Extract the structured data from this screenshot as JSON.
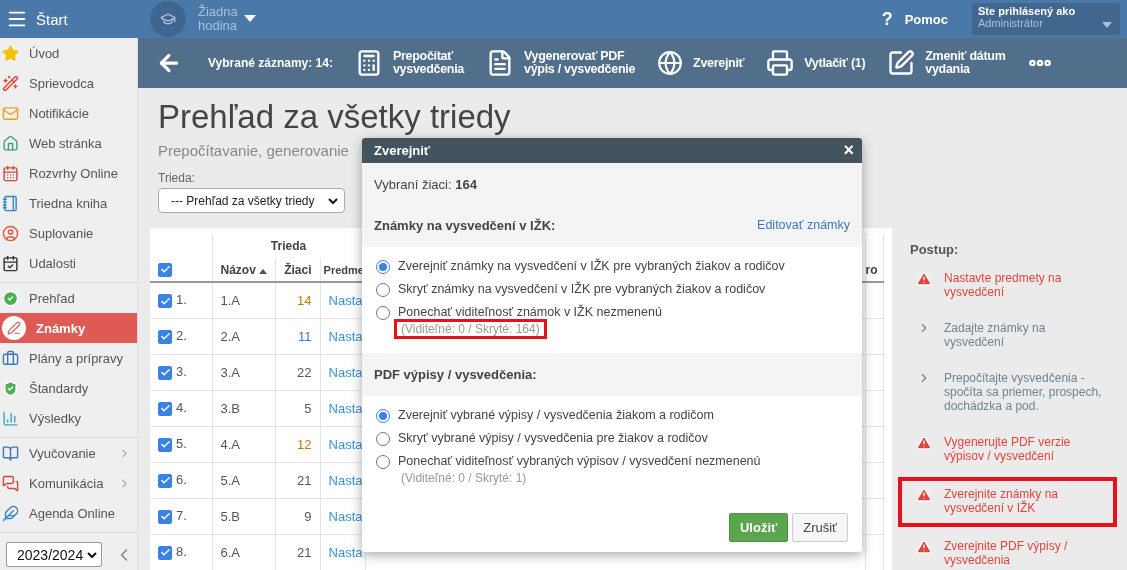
{
  "topbar": {
    "menu_label": "Štart",
    "lesson": [
      "Žiadna",
      "hodina"
    ],
    "help_glyph": "?",
    "help_label": "Pomoc",
    "user_caption": "Ste prihlásený ako",
    "user_name": "Administrátor"
  },
  "sidebar": {
    "sections": [
      [
        {
          "label": "Úvod",
          "selected": false,
          "has_submenu": false
        },
        {
          "label": "Sprievodca",
          "selected": false,
          "has_submenu": false
        },
        {
          "label": "Notifikácie",
          "selected": false,
          "has_submenu": false
        },
        {
          "label": "Web stránka",
          "selected": false,
          "has_submenu": false
        },
        {
          "label": "Rozvrhy Online",
          "selected": false,
          "has_submenu": false
        },
        {
          "label": "Triedna kniha",
          "selected": false,
          "has_submenu": false
        },
        {
          "label": "Suplovanie",
          "selected": false,
          "has_submenu": false
        },
        {
          "label": "Udalosti",
          "selected": false,
          "has_submenu": false
        }
      ],
      [
        {
          "label": "Prehľad",
          "selected": false,
          "has_submenu": false
        },
        {
          "label": "Známky",
          "selected": true,
          "has_submenu": false
        },
        {
          "label": "Plány a prípravy",
          "selected": false,
          "has_submenu": false
        },
        {
          "label": "Štandardy",
          "selected": false,
          "has_submenu": false
        },
        {
          "label": "Výsledky",
          "selected": false,
          "has_submenu": false
        }
      ],
      [
        {
          "label": "Vyučovanie",
          "selected": false,
          "has_submenu": true
        },
        {
          "label": "Komunikácia",
          "selected": false,
          "has_submenu": true
        },
        {
          "label": "Agenda Online",
          "selected": false,
          "has_submenu": false
        }
      ]
    ],
    "year": "2023/2024"
  },
  "toolbar": {
    "selection": "Vybrané záznamy: 14:",
    "actions": [
      {
        "label": [
          "Prepočítať",
          "vysvedčenia"
        ]
      },
      {
        "label": [
          "Vygenerovať PDF",
          "výpis / vysvedčenie"
        ]
      },
      {
        "label": [
          "Zverejniť"
        ]
      },
      {
        "label": [
          "Vytlačiť (1)"
        ]
      },
      {
        "label": [
          "Zmeniť dátum",
          "vydania"
        ]
      }
    ]
  },
  "page": {
    "title": "Prehľad za všetky triedy",
    "subtitle": "Prepočítavanie, generovanie",
    "filter_label": "Trieda:",
    "filter_value": "--- Prehľad za všetky triedy"
  },
  "table": {
    "group_header": "Trieda",
    "select_all_checked": true,
    "columns": [
      "Názov",
      "Žiaci",
      "Predme",
      "ro"
    ],
    "rows": [
      {
        "number": "1.",
        "name": "1.A",
        "students": "14",
        "color": "#c47a00",
        "link": "Nasta",
        "checked": true
      },
      {
        "number": "2.",
        "name": "2.A",
        "students": "11",
        "color": "#3a78c2",
        "link": "Nasta",
        "checked": true
      },
      {
        "number": "3.",
        "name": "3.A",
        "students": "22",
        "color": "#555555",
        "link": "Nasta",
        "checked": true
      },
      {
        "number": "4.",
        "name": "3.B",
        "students": "5",
        "color": "#555555",
        "link": "Nasta",
        "checked": true
      },
      {
        "number": "5.",
        "name": "4.A",
        "students": "12",
        "color": "#c47a00",
        "link": "Nasta",
        "checked": true
      },
      {
        "number": "6.",
        "name": "5.A",
        "students": "21",
        "color": "#555555",
        "link": "Nasta",
        "checked": true
      },
      {
        "number": "7.",
        "name": "5.B",
        "students": "9",
        "color": "#555555",
        "link": "Nasta",
        "checked": true
      },
      {
        "number": "8.",
        "name": "6.A",
        "students": "21",
        "color": "#555555",
        "link": "Nasta",
        "checked": true
      }
    ]
  },
  "steps": {
    "title": "Postup:",
    "items": [
      {
        "kind": "warning",
        "text": "Nastavte predmety na vysvedčení",
        "highlighted": false
      },
      {
        "kind": "pending",
        "text": "Zadajte známky na vysvedčení",
        "highlighted": false
      },
      {
        "kind": "pending",
        "text": "Prepočítajte vysvedčenia - spočíta sa priemer, prospech, dochádzka a pod.",
        "highlighted": false
      },
      {
        "kind": "warning",
        "text": "Vygenerujte PDF verzie výpisov / vysvedčení",
        "highlighted": false
      },
      {
        "kind": "warning",
        "text": "Zverejnite známky na vysvedčení v IŽK",
        "highlighted": true
      },
      {
        "kind": "warning",
        "text": "Zverejnite PDF výpisy / vysvedčenia",
        "highlighted": false
      }
    ]
  },
  "dialog": {
    "title": "Zverejniť",
    "close": "×",
    "summary": "Vybraní žiaci: **164**",
    "sections": [
      {
        "title": "Známky na vysvedčení v IŽK:",
        "link": "Editovať známky",
        "options": [
          {
            "label": "Zverejniť známky na vysvedčení v IŽK pre vybraných žiakov a rodičov",
            "selected": true
          },
          {
            "label": "Skryť známky na vysvedčení v IŽK pre vybraných žiakov a rodičov",
            "selected": false
          },
          {
            "label": "Ponechať viditeľnosť známok v IŽK nezmenenú",
            "selected": false,
            "note": "(Viditeľné: 0 / Skryté: 164)",
            "note_highlighted": true
          }
        ]
      },
      {
        "title": "PDF výpisy / vysvedčenia:",
        "options": [
          {
            "label": "Zverejniť vybrané výpisy / vysvedčenia žiakom a rodičom",
            "selected": true
          },
          {
            "label": "Skryť vybrané výpisy / vysvedčenia pre žiakov a rodičov",
            "selected": false
          },
          {
            "label": "Ponechať viditeľnosť vybraných výpisov / vysvedčení nezmenenú",
            "selected": false,
            "note": "(Viditeľné: 0 / Skryté: 1)",
            "note_highlighted": false
          }
        ]
      }
    ],
    "save": "Uložiť",
    "cancel": "Zrušiť"
  }
}
